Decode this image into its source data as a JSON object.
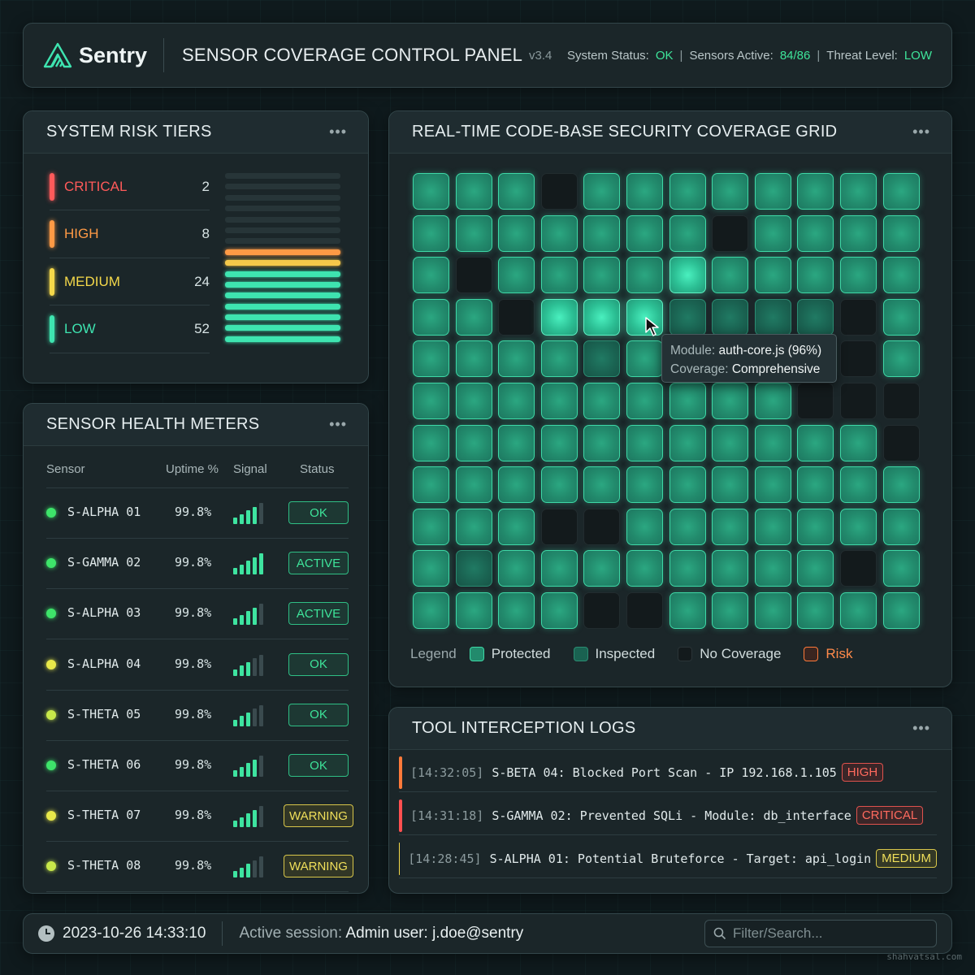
{
  "header": {
    "brand": "Sentry",
    "title": "SENSOR COVERAGE CONTROL PANEL",
    "version": "v3.4",
    "system_status_label": "System Status:",
    "system_status_value": "OK",
    "sensors_active_label": "Sensors Active:",
    "sensors_active_value": "84/86",
    "threat_level_label": "Threat Level:",
    "threat_level_value": "LOW"
  },
  "risk": {
    "title": "SYSTEM RISK TIERS",
    "tiers": [
      {
        "label": "CRITICAL",
        "count": "2",
        "color": "#ff5a5a"
      },
      {
        "label": "HIGH",
        "count": "8",
        "color": "#ff9a45"
      },
      {
        "label": "MEDIUM",
        "count": "24",
        "color": "#f5d94a"
      },
      {
        "label": "LOW",
        "count": "52",
        "color": "#3ee4b0"
      }
    ],
    "stack_colors": [
      "empty",
      "empty",
      "empty",
      "empty",
      "empty",
      "empty",
      "empty",
      "#ff9a45",
      "#f5c84a",
      "#3ee4b0",
      "#3ee4b0",
      "#3ee4b0",
      "#3ee4b0",
      "#3ee4b0",
      "#3ee4b0",
      "#3ee4b0"
    ]
  },
  "health": {
    "title": "SENSOR HEALTH METERS",
    "headers": {
      "sensor": "Sensor",
      "uptime": "Uptime %",
      "signal": "Signal",
      "status": "Status"
    },
    "rows": [
      {
        "name": "S-ALPHA 01",
        "uptime": "99.8%",
        "signal": 4,
        "status": "OK",
        "dot": "#3ee46a",
        "tone": "green"
      },
      {
        "name": "S-GAMMA 02",
        "uptime": "99.8%",
        "signal": 5,
        "status": "ACTIVE",
        "dot": "#3ee46a",
        "tone": "green"
      },
      {
        "name": "S-ALPHA 03",
        "uptime": "99.8%",
        "signal": 4,
        "status": "ACTIVE",
        "dot": "#3ee46a",
        "tone": "green"
      },
      {
        "name": "S-ALPHA 04",
        "uptime": "99.8%",
        "signal": 3,
        "status": "OK",
        "dot": "#e8e84a",
        "tone": "green"
      },
      {
        "name": "S-THETA 05",
        "uptime": "99.8%",
        "signal": 3,
        "status": "OK",
        "dot": "#c8e84a",
        "tone": "green"
      },
      {
        "name": "S-THETA 06",
        "uptime": "99.8%",
        "signal": 4,
        "status": "OK",
        "dot": "#3ee46a",
        "tone": "green"
      },
      {
        "name": "S-THETA 07",
        "uptime": "99.8%",
        "signal": 4,
        "status": "WARNING",
        "dot": "#e8e84a",
        "tone": "yellow"
      },
      {
        "name": "S-THETA 08",
        "uptime": "99.8%",
        "signal": 3,
        "status": "WARNING",
        "dot": "#c8e84a",
        "tone": "yellow"
      }
    ]
  },
  "grid": {
    "title": "REAL-TIME CODE-BASE SECURITY COVERAGE GRID",
    "cells": [
      "PPPNPPPPPPPP",
      "PPPPPPPNPPPP",
      "PNPPPPBPPPPP",
      "PPNBBBIIIINP",
      "PPPPIPPPPPNP",
      "PPPPPPPPPNNN",
      "PPPPPPPPPPPN",
      "PPPPPPPPPPPP",
      "PPPNNPPPPPPP",
      "PIPPPPPPPPNP",
      "PPPPNNPPPPPP"
    ],
    "tooltip": {
      "module_label": "Module:",
      "module_value": "auth-core.js (96%)",
      "coverage_label": "Coverage:",
      "coverage_value": "Comprehensive"
    },
    "legend": {
      "label": "Legend",
      "items": [
        {
          "label": "Protected",
          "kind": "protected"
        },
        {
          "label": "Inspected",
          "kind": "inspected"
        },
        {
          "label": "No Coverage",
          "kind": "none"
        },
        {
          "label": "Risk",
          "kind": "risk"
        }
      ]
    }
  },
  "logs": {
    "title": "TOOL INTERCEPTION LOGS",
    "entries": [
      {
        "time": "[14:32:05]",
        "message": "S-BETA 04: Blocked Port Scan - IP 192.168.1.105",
        "level": "HIGH",
        "color": "#ff7a3a",
        "cls": "b-high"
      },
      {
        "time": "[14:31:18]",
        "message": "S-GAMMA 02: Prevented SQLi - Module: db_interface",
        "level": "CRITICAL",
        "color": "#ff5050",
        "cls": "b-crit"
      },
      {
        "time": "[14:28:45]",
        "message": "S-ALPHA 01: Potential Bruteforce - Target: api_login",
        "level": "MEDIUM",
        "color": "#f5d94a",
        "cls": "b-med"
      }
    ]
  },
  "footer": {
    "datetime": "2023-10-26 14:33:10",
    "session_label": "Active session:",
    "session_user_label": "Admin user:",
    "session_user": "j.doe@sentry",
    "search_placeholder": "Filter/Search..."
  },
  "watermark": "shahvatsal.com"
}
